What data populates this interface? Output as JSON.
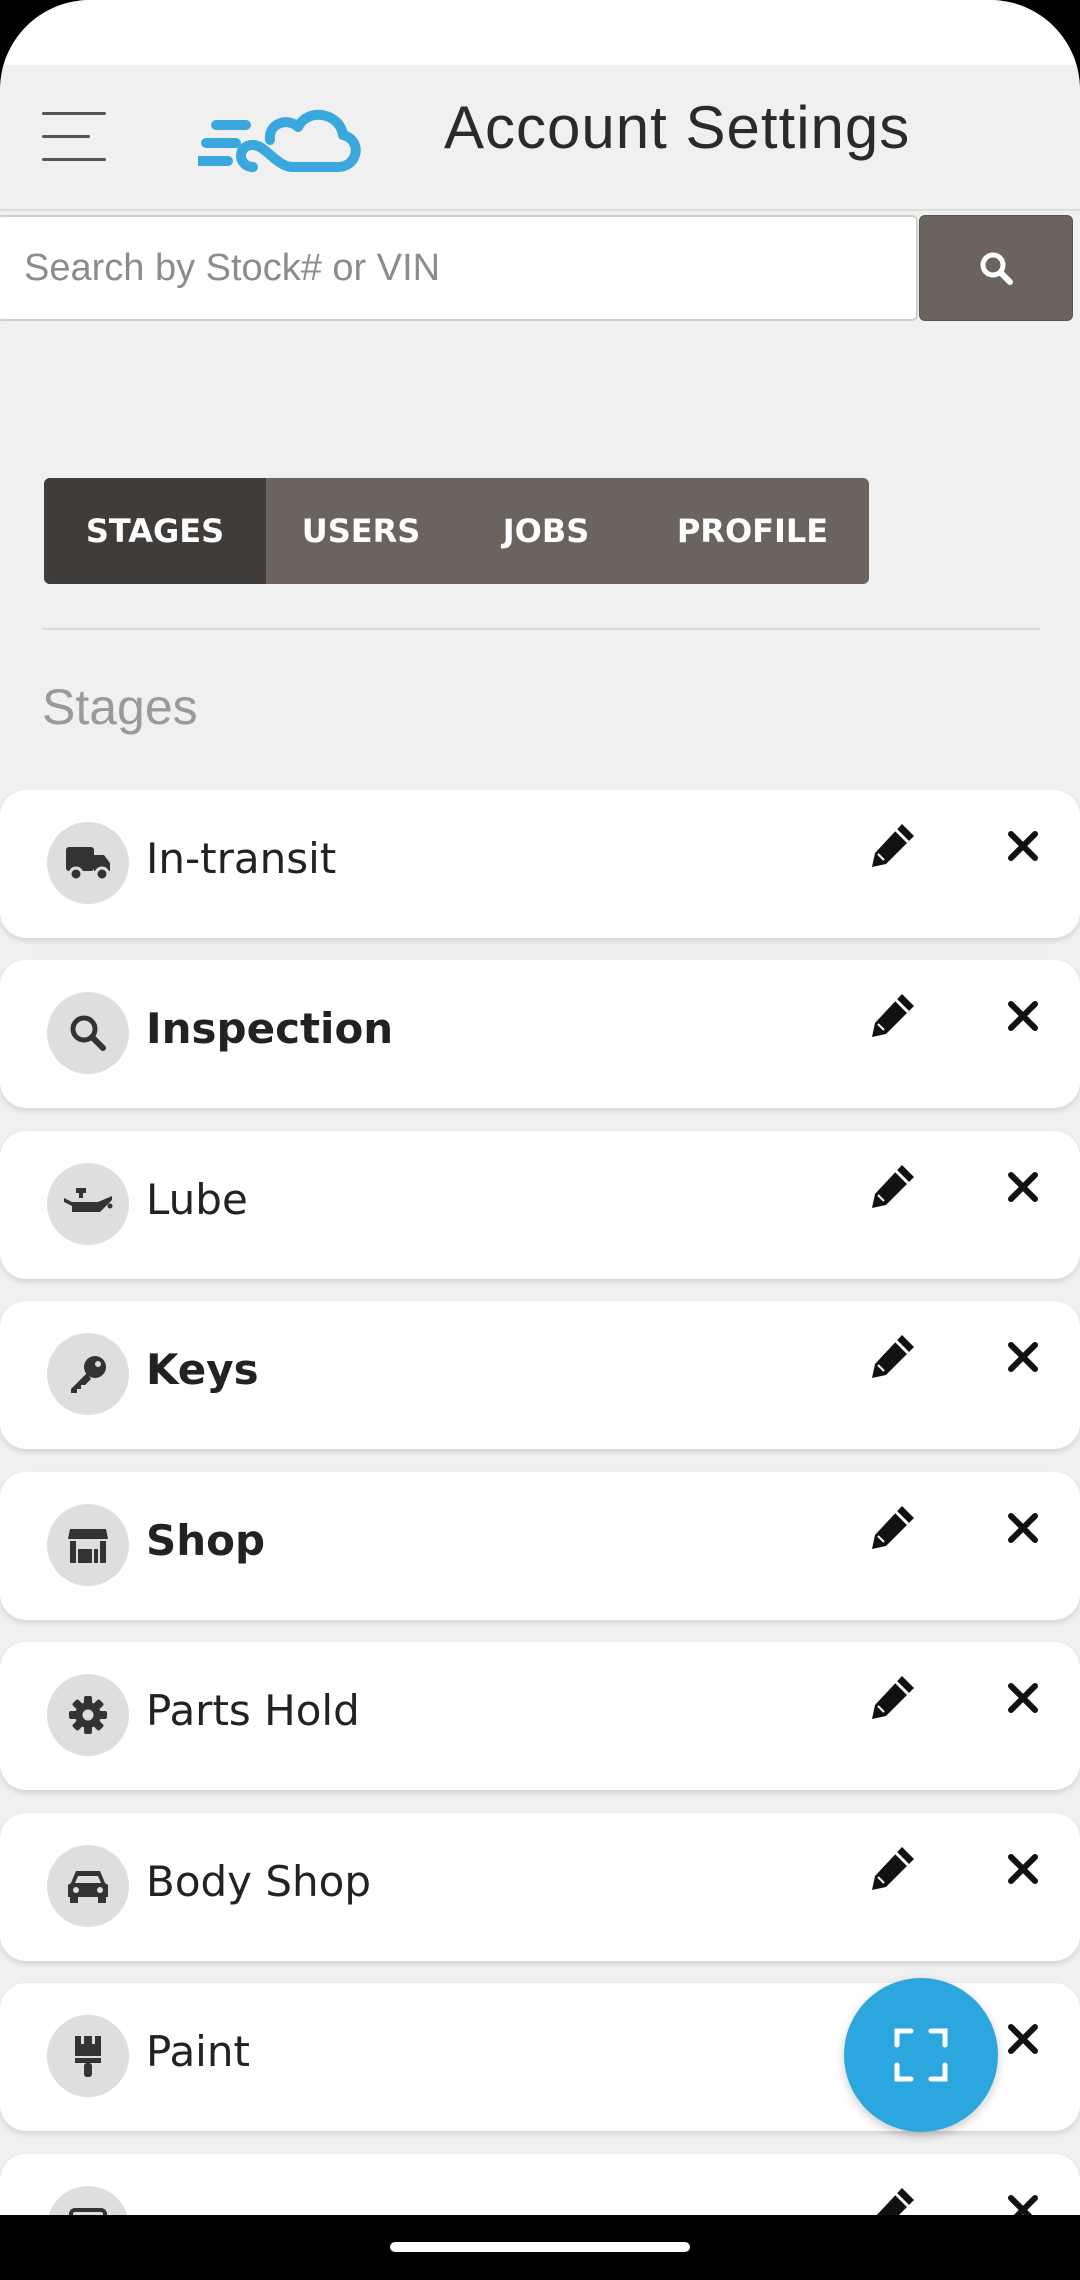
{
  "header": {
    "title": "Account Settings",
    "menu_icon": "hamburger-menu-icon",
    "logo": "cloud-speed-logo"
  },
  "search": {
    "placeholder": "Search by Stock# or VIN",
    "value": "",
    "button_icon": "search-icon"
  },
  "tabs": [
    {
      "label": "STAGES",
      "active": true
    },
    {
      "label": "USERS",
      "active": false
    },
    {
      "label": "JOBS",
      "active": false
    },
    {
      "label": "PROFILE",
      "active": false
    }
  ],
  "section_title": "Stages",
  "stages": [
    {
      "name": "In-transit",
      "icon": "truck-icon",
      "bold": false
    },
    {
      "name": "Inspection",
      "icon": "magnifier-icon",
      "bold": true
    },
    {
      "name": "Lube",
      "icon": "oil-can-icon",
      "bold": false
    },
    {
      "name": "Keys",
      "icon": "key-icon",
      "bold": true
    },
    {
      "name": "Shop",
      "icon": "store-icon",
      "bold": true
    },
    {
      "name": "Parts Hold",
      "icon": "gear-icon",
      "bold": false
    },
    {
      "name": "Body Shop",
      "icon": "car-icon",
      "bold": false
    },
    {
      "name": "Paint",
      "icon": "paint-brush-icon",
      "bold": false
    },
    {
      "name": "",
      "icon": "grid-icon",
      "bold": false
    }
  ],
  "fab": {
    "icon": "scan-frame-icon"
  },
  "colors": {
    "accent": "#2ba6de",
    "tab_bar": "#6b645e",
    "tab_active": "#403c39",
    "background": "#f0f0f0"
  }
}
